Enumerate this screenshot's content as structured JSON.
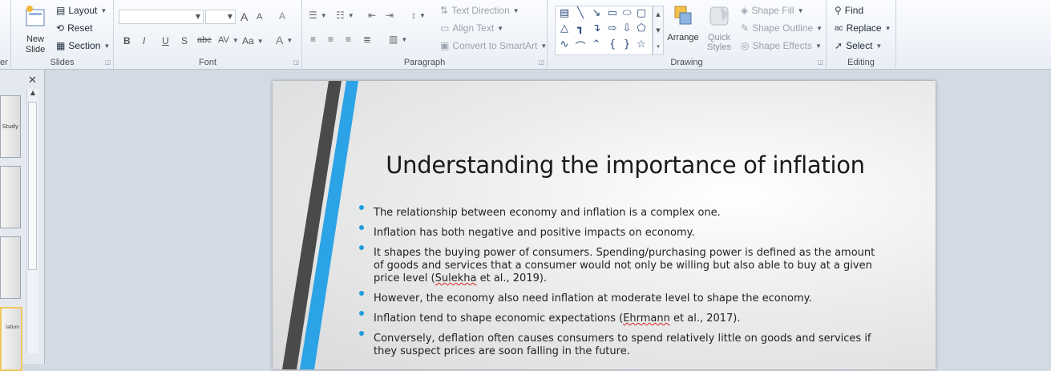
{
  "ribbon": {
    "slides": {
      "label": "Slides",
      "new_slide": "New Slide",
      "layout": "Layout",
      "reset": "Reset",
      "section": "Section",
      "partial_left_label": "er"
    },
    "font": {
      "label": "Font",
      "bold": "B",
      "italic": "I",
      "underline": "U",
      "shadow": "S",
      "strike": "abc",
      "spacing": "AV",
      "case": "Aa",
      "grow": "A",
      "shrink": "A",
      "clear": "A",
      "color": "A"
    },
    "paragraph": {
      "label": "Paragraph",
      "text_direction": "Text Direction",
      "align_text": "Align Text",
      "convert_smartart": "Convert to SmartArt"
    },
    "drawing": {
      "label": "Drawing",
      "arrange": "Arrange",
      "quick_styles": "Quick Styles",
      "shape_fill": "Shape Fill",
      "shape_outline": "Shape Outline",
      "shape_effects": "Shape Effects"
    },
    "editing": {
      "label": "Editing",
      "find": "Find",
      "replace": "Replace",
      "select": "Select"
    }
  },
  "thumbnails": [
    {
      "text": "Study"
    },
    {
      "text": ""
    },
    {
      "text": ""
    },
    {
      "text": "lation"
    }
  ],
  "slide": {
    "title": "Understanding the importance of inflation",
    "bullets": [
      {
        "text": "The relationship between economy and inflation is a complex one."
      },
      {
        "text": "Inflation has both negative and positive impacts on economy."
      },
      {
        "pre": "It shapes the buying power of consumers.  Spending/purchasing power is defined as the amount of goods and services  that a consumer  would not only be willing but also able to buy at a given price level (",
        "cite": "Sulekha",
        "post": " et al., 2019)."
      },
      {
        "text": "However, the economy also need inflation at moderate level to shape the economy."
      },
      {
        "pre": " Inflation tend to shape economic expectations (",
        "cite": "Ehrmann",
        "post": "  et al., 2017)."
      },
      {
        "text": "Conversely,  deflation often causes consumers  to spend relatively little on goods and services  if they suspect prices are soon falling in the future."
      }
    ]
  },
  "colors": {
    "accent_blue": "#1e9ddc",
    "stripe_dark": "#4a4a4a"
  }
}
